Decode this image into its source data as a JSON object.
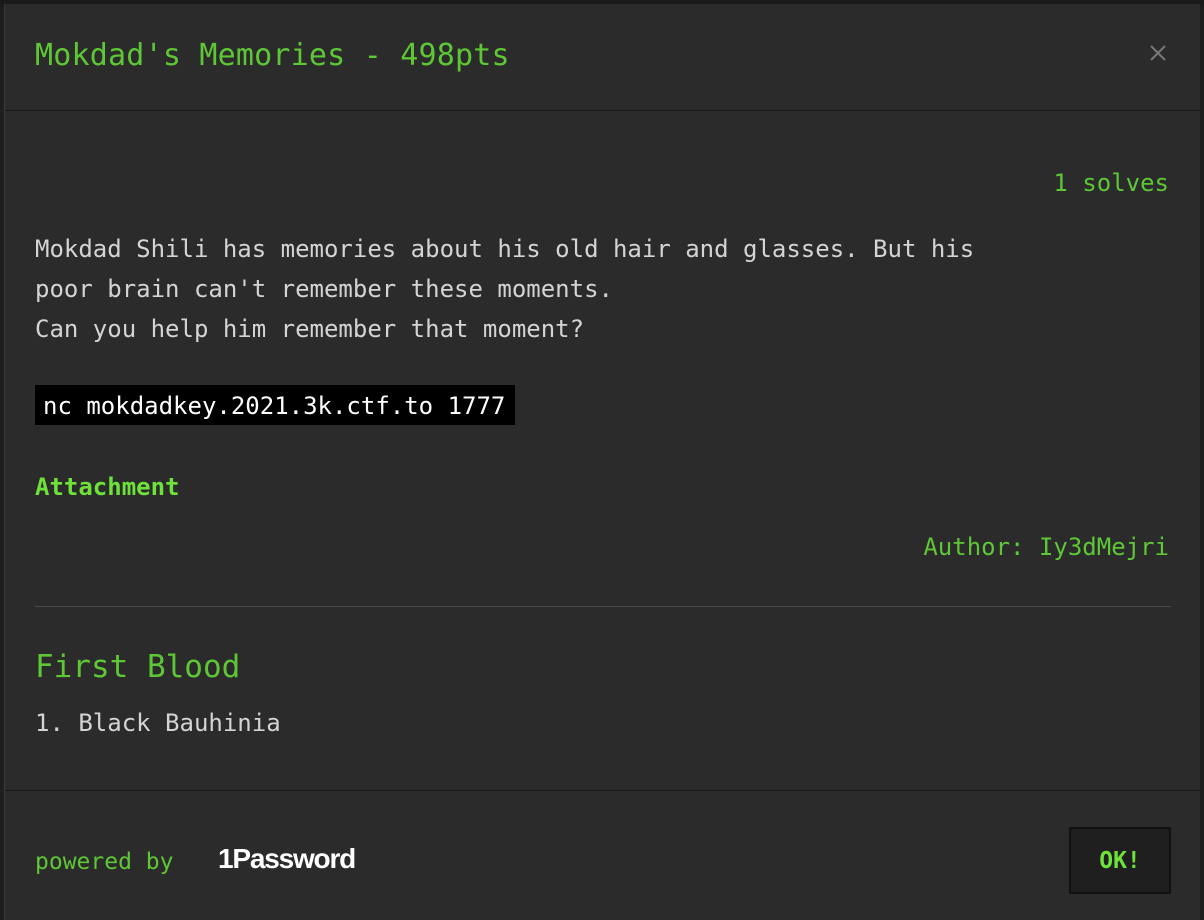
{
  "modal": {
    "title": "Mokdad's Memories - 498pts",
    "close_icon": "close-icon"
  },
  "challenge": {
    "solves": "1 solves",
    "description_lines": [
      "Mokdad Shili has memories about his old hair and glasses. But his",
      "poor brain can't remember these moments.",
      "Can you help him remember that moment?"
    ],
    "command": "nc mokdadkey.2021.3k.ctf.to 1777",
    "attachment_label": "Attachment",
    "author": "Author: Iy3dMejri"
  },
  "first_blood": {
    "heading": "First Blood",
    "entries": [
      "1. Black Bauhinia"
    ]
  },
  "footer": {
    "powered_by": "powered by",
    "brand_logo_text": "1Password",
    "ok_label": "OK!"
  },
  "colors": {
    "accent_green": "#5ec736",
    "bright_green": "#6fe23a",
    "modal_bg": "#2b2b2b",
    "text_light": "#d4d4d4",
    "code_bg": "#000000"
  }
}
